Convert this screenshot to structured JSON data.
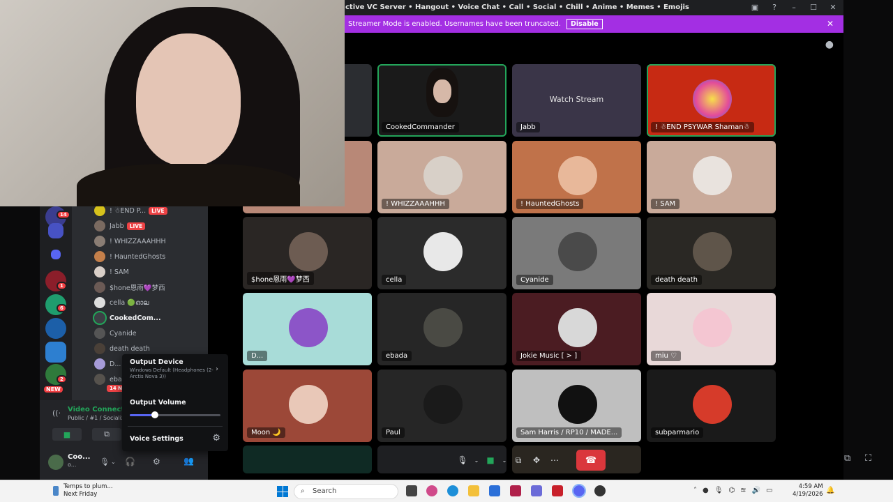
{
  "window": {
    "title": "ctive VC Server • Hangout • Voice Chat • Call • Social • Chill • Anime • Memes • Emojis"
  },
  "streamer_banner": {
    "message": "Streamer Mode is enabled. Usernames have been truncated.",
    "disable_label": "Disable"
  },
  "server_badges": {
    "s1": "14",
    "s2": "1",
    "s3": "6",
    "s4": "2",
    "new": "NEW",
    "mentions": "14 NEW M"
  },
  "members": [
    {
      "name": "! ☃END P...",
      "live": "LIVE"
    },
    {
      "name": "Jabb",
      "live": "LIVE"
    },
    {
      "name": "! WHIZZAAAHHH",
      "live": ""
    },
    {
      "name": "! HauntedGhosts",
      "live": ""
    },
    {
      "name": "! SAM",
      "live": ""
    },
    {
      "name": "$hone恩雨💜梦西",
      "live": ""
    },
    {
      "name": "cella 🟢ഓല",
      "live": ""
    },
    {
      "name": "CookedCom...",
      "live": ""
    },
    {
      "name": "Cyanide",
      "live": ""
    },
    {
      "name": "death death",
      "live": ""
    },
    {
      "name": "D...",
      "live": ""
    },
    {
      "name": "eba",
      "live": ""
    }
  ],
  "voice_panel": {
    "status": "Video Connected",
    "channel": "Public / #1 / Socialize",
    "user_name": "Coo...",
    "user_tag": "o..."
  },
  "audio_popup": {
    "output_device_label": "Output Device",
    "output_device_value": "Windows Default (Headphones (2- Arctis Nova 3))",
    "output_volume_label": "Output Volume",
    "output_volume": 0.28,
    "voice_settings_label": "Voice Settings"
  },
  "tiles": [
    {
      "label": "CookedCommander"
    },
    {
      "label": "Watch Stream",
      "label2": "Jabb"
    },
    {
      "label": "! ☃END PSYWAR Shaman☃"
    },
    {
      "label": "! WHIZZAAAHHH"
    },
    {
      "label": "! HauntedGhosts"
    },
    {
      "label": "! SAM"
    },
    {
      "label": "$hone恩雨💜梦西"
    },
    {
      "label": "cella"
    },
    {
      "label": "Cyanide"
    },
    {
      "label": "death death"
    },
    {
      "label": "D..."
    },
    {
      "label": "ebada"
    },
    {
      "label": "Jokie Music [ > ]"
    },
    {
      "label": "miu ♡"
    },
    {
      "label": "Moon 🌙"
    },
    {
      "label": "Paul"
    },
    {
      "label": "Sam Harris / RP10 / MADE..."
    },
    {
      "label": "subparmario"
    }
  ],
  "taskbar": {
    "weather_line1": "Temps to plum...",
    "weather_line2": "Next Friday",
    "search_placeholder": "Search",
    "time": "4:59 AM",
    "date": "4/19/2026"
  },
  "colors": {
    "streamer_purple": "#a32fe3",
    "speaking_green": "#23a55a",
    "leave_red": "#da373c",
    "blurple": "#5865f2"
  }
}
